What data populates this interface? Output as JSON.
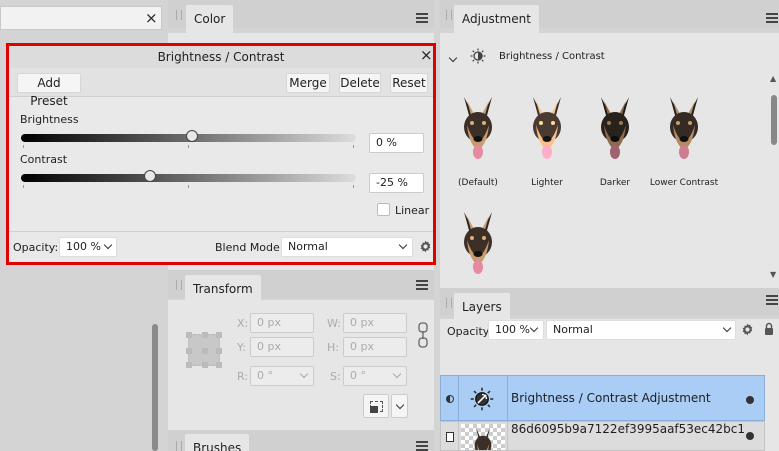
{
  "left_panel": {
    "close_glyph": "×"
  },
  "color_panel": {
    "tab_label": "Color"
  },
  "dialog": {
    "title": "Brightness / Contrast",
    "close_glyph": "×",
    "add_preset_label": "Add Preset",
    "merge_label": "Merge",
    "delete_label": "Delete",
    "reset_label": "Reset",
    "brightness_label": "Brightness",
    "brightness_value": "0 %",
    "brightness_level": 0,
    "contrast_label": "Contrast",
    "contrast_value": "-25 %",
    "contrast_level": -25,
    "linear_label": "Linear",
    "linear_checked": false,
    "opacity_label": "Opacity:",
    "opacity_value": "100 %",
    "blend_mode_label": "Blend Mode:",
    "blend_mode_value": "Normal"
  },
  "adjustment_panel": {
    "tab_label": "Adjustment",
    "header_label": "Brightness / Contrast",
    "presets": [
      {
        "label": "(Default)"
      },
      {
        "label": "Lighter"
      },
      {
        "label": "Darker"
      },
      {
        "label": "Lower Contrast"
      },
      {
        "label": ""
      }
    ]
  },
  "transform_panel": {
    "tab_label": "Transform",
    "x_label": "X:",
    "x_value": "0 px",
    "y_label": "Y:",
    "y_value": "0 px",
    "w_label": "W:",
    "w_value": "0 px",
    "h_label": "H:",
    "h_value": "0 px",
    "r_label": "R:",
    "r_value": "0 °",
    "s_label": "S:",
    "s_value": "0 °"
  },
  "brushes_panel": {
    "tab_label": "Brushes"
  },
  "layers_panel": {
    "tab_label": "Layers",
    "opacity_label": "Opacity:",
    "opacity_value": "100 %",
    "blend_mode_value": "Normal",
    "layers": [
      {
        "name": "Brightness / Contrast Adjustment",
        "selected": true
      },
      {
        "name": "86d6095b9a7122ef3995aaf53ec42bc1",
        "selected": false
      }
    ]
  },
  "colors": {
    "highlight_border": "#e00000",
    "selected_layer": "#a9cdf5"
  },
  "icons": [
    "close-icon",
    "grip-icon",
    "menu-icon",
    "chevron-down-icon",
    "sun-icon",
    "gear-icon",
    "lock-icon",
    "link-icon",
    "visibility-icon",
    "dog-thumbnail"
  ]
}
